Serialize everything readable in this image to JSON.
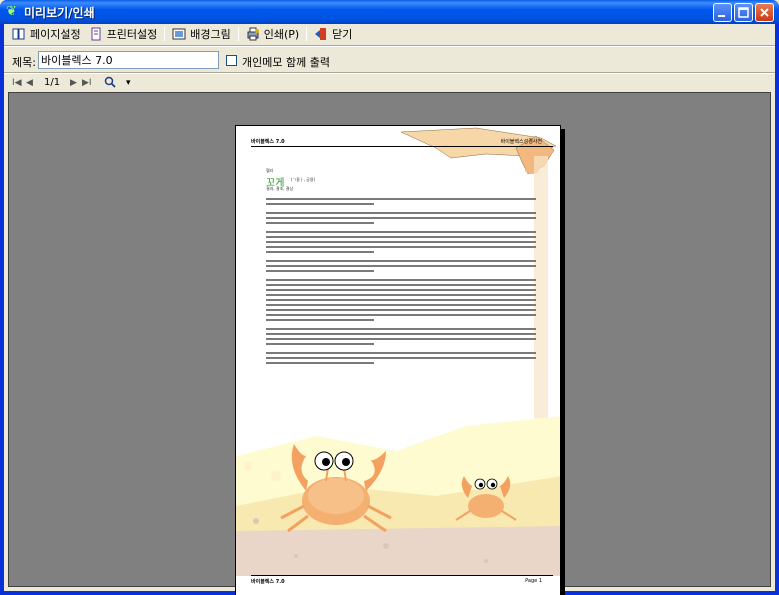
{
  "window": {
    "title": "미리보기/인쇄"
  },
  "toolbar": {
    "page_setup": "페이지설정",
    "printer_setup": "프린터설정",
    "background": "배경그림",
    "print": "인쇄(P)",
    "close": "닫기"
  },
  "title_row": {
    "label": "제목:",
    "value": "바이블렉스 7.0",
    "memo_checkbox_label": "개인메모 함께 출력",
    "memo_checked": false
  },
  "nav": {
    "first": "I◀",
    "prev": "◀",
    "page": "1/1",
    "next": "▶",
    "last": "▶I",
    "zoom_icon": "magnifier-icon",
    "zoom_dropdown": "▾"
  },
  "page": {
    "header_left": "바이블렉스 7.0",
    "header_right": "바이블렉스성경사전",
    "word_small": "헬라",
    "word_big": "꼬게",
    "word_hanja": "(ㄱ용ㅏ,  궁용)",
    "word_sub": "결과,  결조,  결상",
    "footer_left": "바이블렉스 7.0",
    "footer_right": "Page 1"
  }
}
